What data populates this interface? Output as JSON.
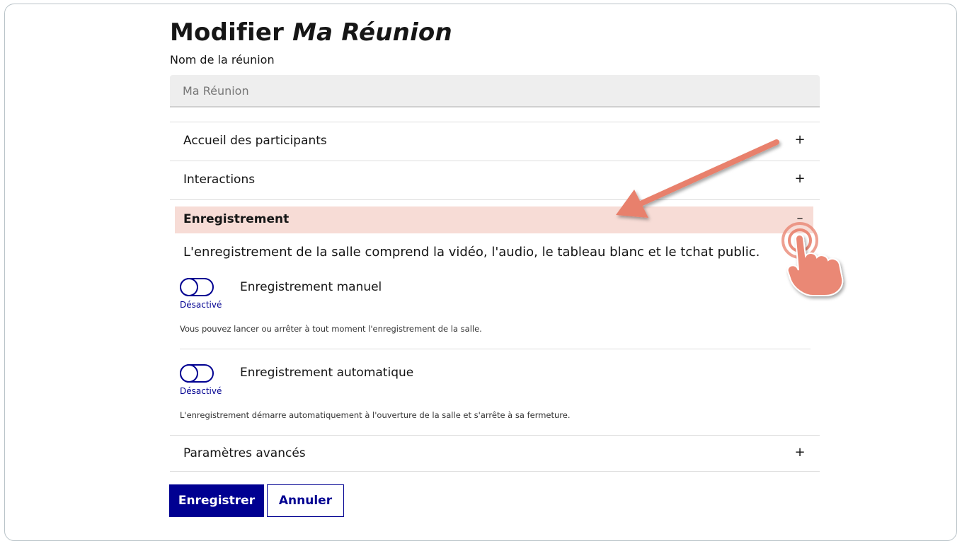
{
  "page": {
    "title_prefix": "Modifier",
    "title_name": "Ma Réunion"
  },
  "name_field": {
    "label": "Nom de la réunion",
    "value": "Ma Réunion"
  },
  "accordion": {
    "reception": {
      "label": "Accueil des participants",
      "sign": "+"
    },
    "interactions": {
      "label": "Interactions",
      "sign": "+"
    },
    "recording": {
      "label": "Enregistrement",
      "sign": "–",
      "description": "L'enregistrement de la salle comprend la vidéo, l'audio, le tableau blanc et le tchat public.",
      "manual": {
        "label": "Enregistrement manuel",
        "state": "Désactivé",
        "hint": "Vous pouvez lancer ou arrêter à tout moment l'enregistrement de la salle."
      },
      "automatic": {
        "label": "Enregistrement automatique",
        "state": "Désactivé",
        "hint": "L'enregistrement démarre automatiquement à l'ouverture de la salle et s'arrête à sa fermeture."
      }
    },
    "advanced": {
      "label": "Paramètres avancés",
      "sign": "+"
    }
  },
  "actions": {
    "save_label": "Enregistrer",
    "cancel_label": "Annuler"
  },
  "colors": {
    "primary": "#000091",
    "active_section_bg": "#f7dcd6",
    "annotation": "#e8806c"
  },
  "annotations": {
    "arrow": "arrow-icon",
    "hand": "tap-hand-icon"
  }
}
